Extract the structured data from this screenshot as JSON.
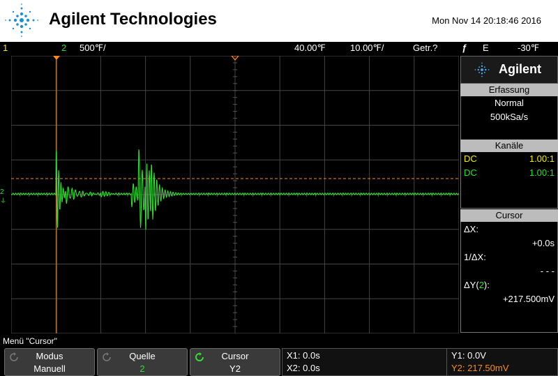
{
  "header": {
    "brand": "Agilent Technologies",
    "datetime": "Mon Nov 14 20:18:46 2016"
  },
  "status": {
    "ch1_label": "1",
    "ch2_label": "2",
    "ch2_scale": "500℉/",
    "time_position": "40.00℉",
    "time_scale": "10.00℉/",
    "acq_state": "Getr.?",
    "trigger_symbol": "ƒ",
    "trigger_source": "E",
    "trigger_level": "-30℉"
  },
  "scope": {
    "ground_marker": "2",
    "trace_color": "#33dd33",
    "cursor_color": "#ff8c1a"
  },
  "panel": {
    "brand": "Agilent",
    "acquisition": {
      "title": "Erfassung",
      "mode": "Normal",
      "rate": "500kSa/s"
    },
    "channels": {
      "title": "Kanäle",
      "rows": [
        {
          "coupling": "DC",
          "probe": "1.00:1",
          "color": "#f4ea00"
        },
        {
          "coupling": "DC",
          "probe": "1.00:1",
          "color": "#33dd33"
        }
      ]
    },
    "cursor": {
      "title": "Cursor",
      "dx_label": "ΔX:",
      "dx_value": "+0.0s",
      "inv_dx_label": "1/ΔX:",
      "inv_dx_value": "- - -",
      "dy_label_prefix": "ΔY(",
      "dy_label_channel": "2",
      "dy_label_suffix": "):",
      "dy_value": "+217.500mV"
    }
  },
  "menu": {
    "label": "Menü \"Cursor\""
  },
  "softkeys": [
    {
      "title": "Modus",
      "value": "Manuell"
    },
    {
      "title": "Quelle",
      "value": "2"
    },
    {
      "title": "Cursor",
      "value": "Y2"
    }
  ],
  "readouts": {
    "x1": "X1: 0.0s",
    "x2": "X2: 0.0s",
    "y1": "Y1: 0.0V",
    "y2": "Y2: 217.50mV"
  }
}
